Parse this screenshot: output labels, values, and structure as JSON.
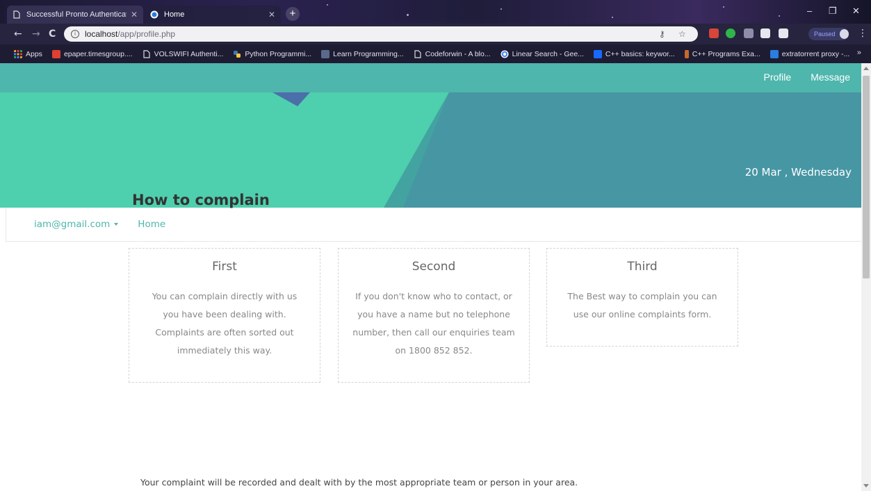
{
  "browser": {
    "tabs": [
      {
        "title": "Successful Pronto Authentication",
        "active": false
      },
      {
        "title": "Home",
        "active": true
      }
    ],
    "new_tab_symbol": "+",
    "window_controls": {
      "minimize": "–",
      "maximize": "❐",
      "close": "✕"
    },
    "nav": {
      "back": "←",
      "forward": "→",
      "reload": "C"
    },
    "url": {
      "host": "localhost",
      "path": "/app/profile.php"
    },
    "paused_label": "Paused",
    "menu_symbol": "⋮",
    "bookmarks": [
      {
        "label": "Apps",
        "icon": "apps-grid-icon",
        "color": "#f2a23a"
      },
      {
        "label": "epaper.timesgroup....",
        "icon": "epaper-icon",
        "color": "#e0402f"
      },
      {
        "label": "VOLSWIFI Authenti...",
        "icon": "page-icon",
        "color": "#cccccc"
      },
      {
        "label": "Python Programmi...",
        "icon": "python-icon",
        "color": "#3e78b2"
      },
      {
        "label": "Learn Programming...",
        "icon": "learn-icon",
        "color": "#5a6a8a"
      },
      {
        "label": "Codeforwin - A blo...",
        "icon": "page-icon",
        "color": "#cccccc"
      },
      {
        "label": "Linear Search - Gee...",
        "icon": "google-icon",
        "color": "#4285f4"
      },
      {
        "label": "C++ basics: keywor...",
        "icon": "behance-icon",
        "color": "#1769ff"
      },
      {
        "label": "C++ Programs Exa...",
        "icon": "cpp-icon",
        "color": "#c8682b"
      },
      {
        "label": "extratorrent proxy -...",
        "icon": "s-icon",
        "color": "#2a7de1"
      }
    ],
    "bookmarks_more": "»"
  },
  "page": {
    "topnav": {
      "profile": "Profile",
      "message": "Message"
    },
    "date": "20 Mar , Wednesday",
    "subnav": {
      "user_email": "iam@gmail.com",
      "home": "Home"
    },
    "title": "How to complain",
    "cards": [
      {
        "heading": "First",
        "body": "You can complain directly with us you have been dealing with. Complaints are often sorted out immediately this way."
      },
      {
        "heading": "Second",
        "body": "If you don't know who to contact, or you have a name but no telephone number, then call our enquiries team on 1800 852 852."
      },
      {
        "heading": "Third",
        "body": "The Best way to complain you can use our online complaints form."
      }
    ],
    "footnote": "Your complaint will be recorded and dealt with by the most appropriate team or person in your area."
  },
  "colors": {
    "accent": "#4eb6ad",
    "hero_left": "#4ecfad",
    "hero_right": "#4796a4",
    "hero_triangle": "#4b6fa8"
  }
}
